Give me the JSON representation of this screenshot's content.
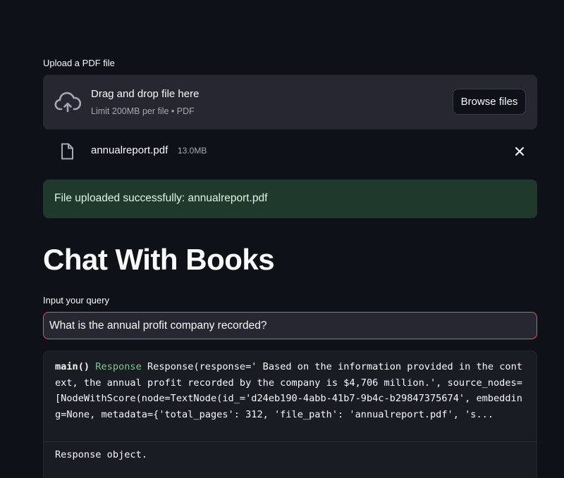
{
  "uploader": {
    "label": "Upload a PDF file",
    "dropzone_title": "Drag and drop file here",
    "dropzone_limit": "Limit 200MB per file • PDF",
    "browse_label": "Browse files",
    "file": {
      "name": "annualreport.pdf",
      "size": "13.0MB"
    }
  },
  "alert": {
    "success_text": "File uploaded successfully: annualreport.pdf",
    "color": "#1f3a2b"
  },
  "title": "Chat With Books",
  "query": {
    "label": "Input your query",
    "value": "What is the annual profit company recorded?",
    "focus_color": "#ff4b4b"
  },
  "output": {
    "function_name": "main()",
    "type_name": "Response",
    "repr": "Response(response=' Based on the information provided in the context, the annual profit recorded by the company is $4,706 million.', source_nodes=[NodeWithScore(node=TextNode(id_='d24eb190-4abb-41b7-9b4c-b29847375674', embedding=None, metadata={'total_pages': 312, 'file_path': 'annualreport.pdf', 's...",
    "doc": "Response object."
  },
  "icons": {
    "upload": "cloud-upload-icon",
    "file": "file-icon",
    "close": "close-icon"
  },
  "theme": {
    "background": "#0e1117",
    "surface": "#262730",
    "accent": "#ff4b4b",
    "type_color": "#7ec98a"
  }
}
